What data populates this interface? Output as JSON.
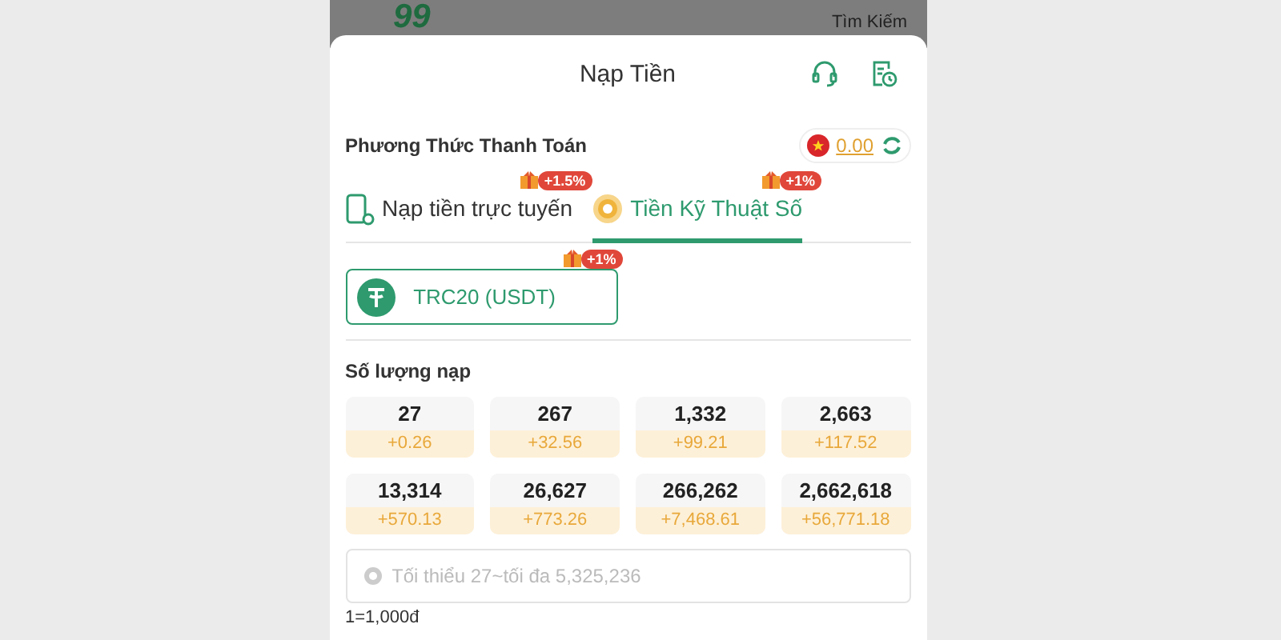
{
  "background_header": {
    "logo_fragment": "99",
    "search_label": "Tìm Kiếm"
  },
  "dialog": {
    "title": "Nạp Tiền"
  },
  "payment_method": {
    "label": "Phương Thức Thanh Toán",
    "balance": "0.00"
  },
  "tabs": [
    {
      "label": "Nạp tiền trực tuyến",
      "kind": "phone",
      "bonus": "+1.5%",
      "selected": false
    },
    {
      "label": "Tiền Kỹ Thuật Số",
      "kind": "coin",
      "bonus": "+1%",
      "selected": true
    }
  ],
  "channels": [
    {
      "label": "TRC20 (USDT)",
      "bonus": "+1%",
      "selected": true
    }
  ],
  "amount": {
    "label": "Số lượng nạp",
    "options": [
      {
        "amount": "27",
        "bonus": "+0.26"
      },
      {
        "amount": "267",
        "bonus": "+32.56"
      },
      {
        "amount": "1,332",
        "bonus": "+99.21"
      },
      {
        "amount": "2,663",
        "bonus": "+117.52"
      },
      {
        "amount": "13,314",
        "bonus": "+570.13"
      },
      {
        "amount": "26,627",
        "bonus": "+773.26"
      },
      {
        "amount": "266,262",
        "bonus": "+7,468.61"
      },
      {
        "amount": "2,662,618",
        "bonus": "+56,771.18"
      }
    ],
    "placeholder": "Tối thiểu 27~tối đa 5,325,236",
    "rate": "1=1,000đ"
  }
}
